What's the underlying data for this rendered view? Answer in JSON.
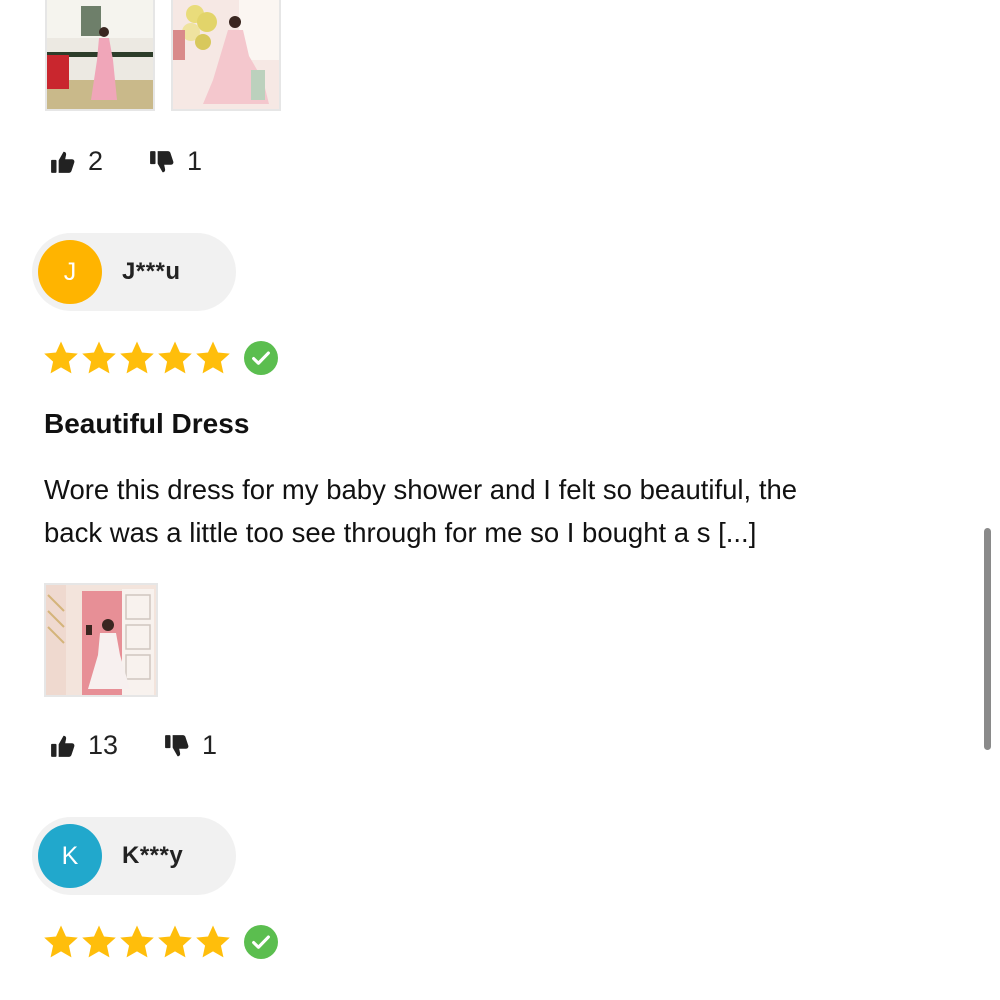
{
  "reviews": [
    {
      "photos": [
        {
          "icon": "photo-pink-feather-gown-standing"
        },
        {
          "icon": "photo-pink-feather-gown-balloons"
        }
      ],
      "helpful_count": "2",
      "unhelpful_count": "1"
    },
    {
      "reviewer": {
        "initial": "J",
        "name": "J***u",
        "avatar_color": "#FFB400"
      },
      "stars": 5,
      "verified": true,
      "title": "Beautiful Dress",
      "body_line1": "Wore this dress for my baby shower and I felt so beautiful, the",
      "body_line2": "back was a little too see through for me so I bought a s [...]",
      "photos": [
        {
          "icon": "photo-white-feather-gown-doorway"
        }
      ],
      "helpful_count": "13",
      "unhelpful_count": "1"
    },
    {
      "reviewer": {
        "initial": "K",
        "name": "K***y",
        "avatar_color": "#21A8CC"
      },
      "stars": 5,
      "verified": true
    }
  ],
  "colors": {
    "star": "#FFBE0B",
    "verified": "#5BBE4F",
    "chip_bg": "#F1F1F1",
    "scrollbar": "#8A8A8A"
  }
}
